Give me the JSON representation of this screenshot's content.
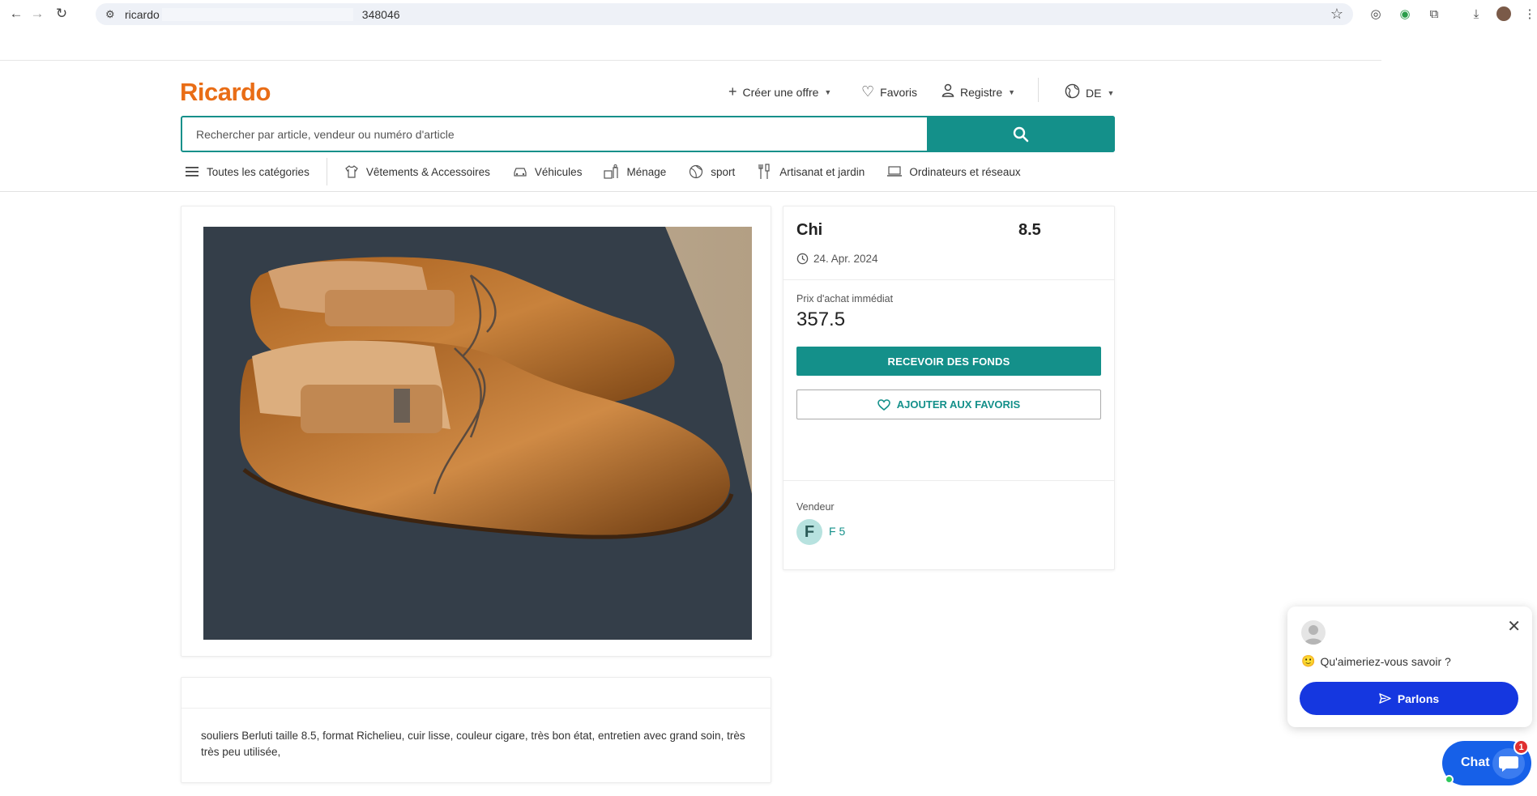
{
  "browser": {
    "url": "ricardo",
    "url_suffix": "348046",
    "icons": [
      "back-icon",
      "forward-icon",
      "reload-icon",
      "site-info-icon",
      "bookmark-star-icon",
      "extension-icon",
      "download-icon",
      "profile-avatar-icon",
      "menu-icon"
    ]
  },
  "header": {
    "logo": "Ricardo",
    "create_offer": "Créer une offre",
    "favorites": "Favoris",
    "register": "Registre",
    "language": "DE"
  },
  "search": {
    "placeholder": "Rechercher par article, vendeur ou numéro d'article"
  },
  "categories": [
    {
      "label": "Toutes les catégories",
      "icon": "hamburger-icon"
    },
    {
      "label": "Vêtements & Accessoires",
      "icon": "shirt-icon"
    },
    {
      "label": "Véhicules",
      "icon": "car-icon"
    },
    {
      "label": "Ménage",
      "icon": "household-icon"
    },
    {
      "label": "sport",
      "icon": "ball-icon"
    },
    {
      "label": "Artisanat et jardin",
      "icon": "tools-icon"
    },
    {
      "label": "Ordinateurs et réseaux",
      "icon": "laptop-icon"
    }
  ],
  "listing": {
    "title_start": "Chi",
    "title_end": "8.5",
    "date": "24. Apr. 2024",
    "price_label": "Prix d'achat immédiat",
    "price": "357.5",
    "primary_button": "RECEVOIR DES FONDS",
    "favorite_button": "AJOUTER AUX FAVORIS",
    "seller_label": "Vendeur",
    "seller_initial": "F",
    "seller_name": "F 5",
    "description": "souliers Berluti taille 8.5, format Richelieu, cuir lisse, couleur cigare, très bon état, entretien avec grand soin, très très peu utilisée,"
  },
  "chat": {
    "question": "Qu'aimeriez-vous savoir ?",
    "button": "Parlons",
    "launcher_label": "Chat",
    "badge_count": "1"
  },
  "colors": {
    "brand_orange": "#e96d16",
    "teal": "#14908a",
    "chat_blue": "#1537e0"
  }
}
